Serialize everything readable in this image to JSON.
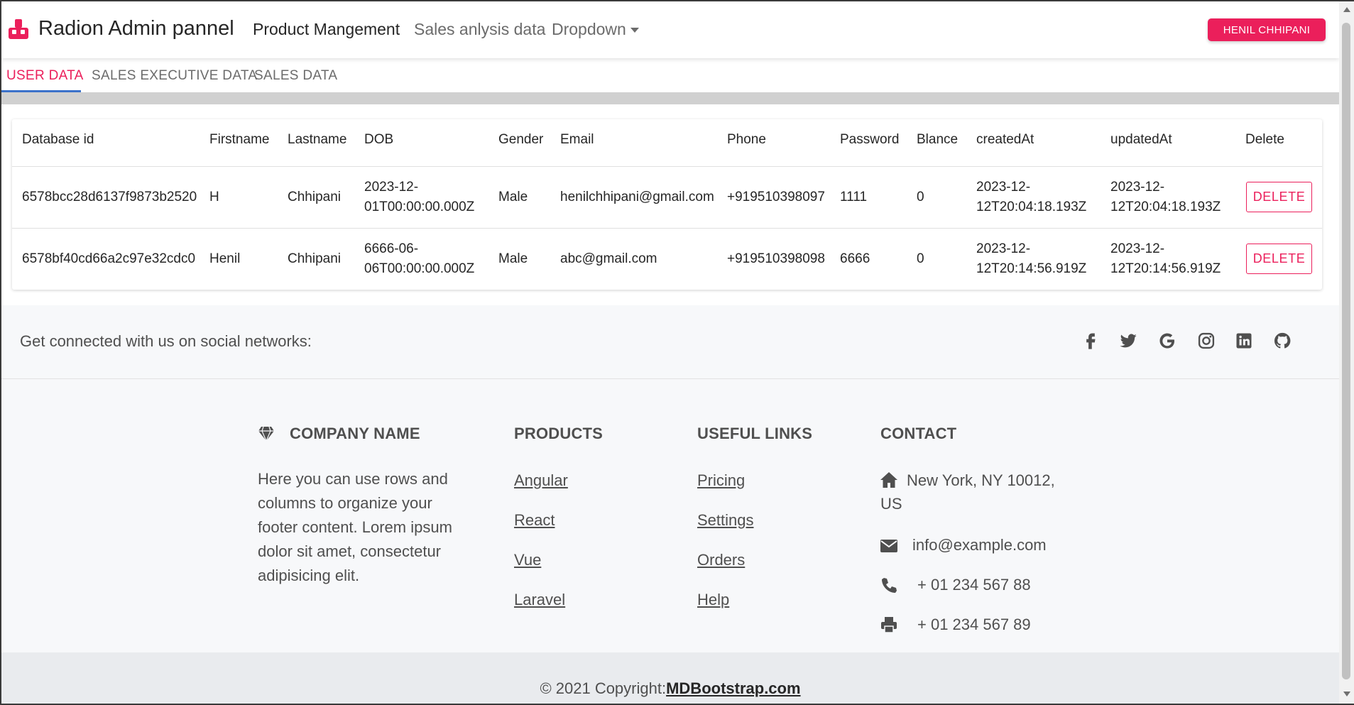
{
  "navbar": {
    "brand": "Radion Admin pannel",
    "links": [
      "Product Mangement",
      "Sales anlysis data",
      "Dropdown"
    ],
    "user_button": "HENIL CHHIPANI"
  },
  "tabs": [
    "USER DATA",
    "SALES EXECUTIVE DATA",
    "SALES DATA"
  ],
  "table": {
    "headers": [
      "Database id",
      "Firstname",
      "Lastname",
      "DOB",
      "Gender",
      "Email",
      "Phone",
      "Password",
      "Blance",
      "createdAt",
      "updatedAt",
      "Delete"
    ],
    "rows": [
      {
        "id": "6578bcc28d6137f9873b2520",
        "firstname": "H",
        "lastname": "Chhipani",
        "dob_line1": "2023-12-",
        "dob_line2": "01T00:00:00.000Z",
        "gender": "Male",
        "email": "henilchhipani@gmail.com",
        "phone": "+919510398097",
        "password": "1111",
        "balance": "0",
        "created_line1": "2023-12-",
        "created_line2": "12T20:04:18.193Z",
        "updated_line1": "2023-12-",
        "updated_line2": "12T20:04:18.193Z",
        "delete_label": "DELETE"
      },
      {
        "id": "6578bf40cd66a2c97e32cdc0",
        "firstname": "Henil",
        "lastname": "Chhipani",
        "dob_line1": "6666-06-",
        "dob_line2": "06T00:00:00.000Z",
        "gender": "Male",
        "email": "abc@gmail.com",
        "phone": "+919510398098",
        "password": "6666",
        "balance": "0",
        "created_line1": "2023-12-",
        "created_line2": "12T20:14:56.919Z",
        "updated_line1": "2023-12-",
        "updated_line2": "12T20:14:56.919Z",
        "delete_label": "DELETE"
      }
    ]
  },
  "social": {
    "text": "Get connected with us on social networks:",
    "icons": [
      "facebook-icon",
      "twitter-icon",
      "google-icon",
      "instagram-icon",
      "linkedin-icon",
      "github-icon"
    ]
  },
  "footer": {
    "company_title": "COMPANY NAME",
    "company_text": "Here you can use rows and columns to organize your footer content. Lorem ipsum dolor sit amet, consectetur adipisicing elit.",
    "products_title": "PRODUCTS",
    "products": [
      "Angular",
      "React",
      "Vue",
      "Laravel"
    ],
    "useful_title": "USEFUL LINKS",
    "useful": [
      "Pricing",
      "Settings",
      "Orders",
      "Help"
    ],
    "contact_title": "CONTACT",
    "address_line1": "New York, NY 10012,",
    "address_line2": "US",
    "email": "info@example.com",
    "phone": "+ 01 234 567 88",
    "fax": "+ 01 234 567 89"
  },
  "copyright": {
    "prefix": "© 2021 Copyright:",
    "link": "MDBootstrap.com"
  },
  "colors": {
    "accent": "#eb1f5b",
    "tab_underline": "#3b71ca",
    "footer_bg": "#f7f8fa",
    "copyright_bg": "#e9ebee"
  }
}
